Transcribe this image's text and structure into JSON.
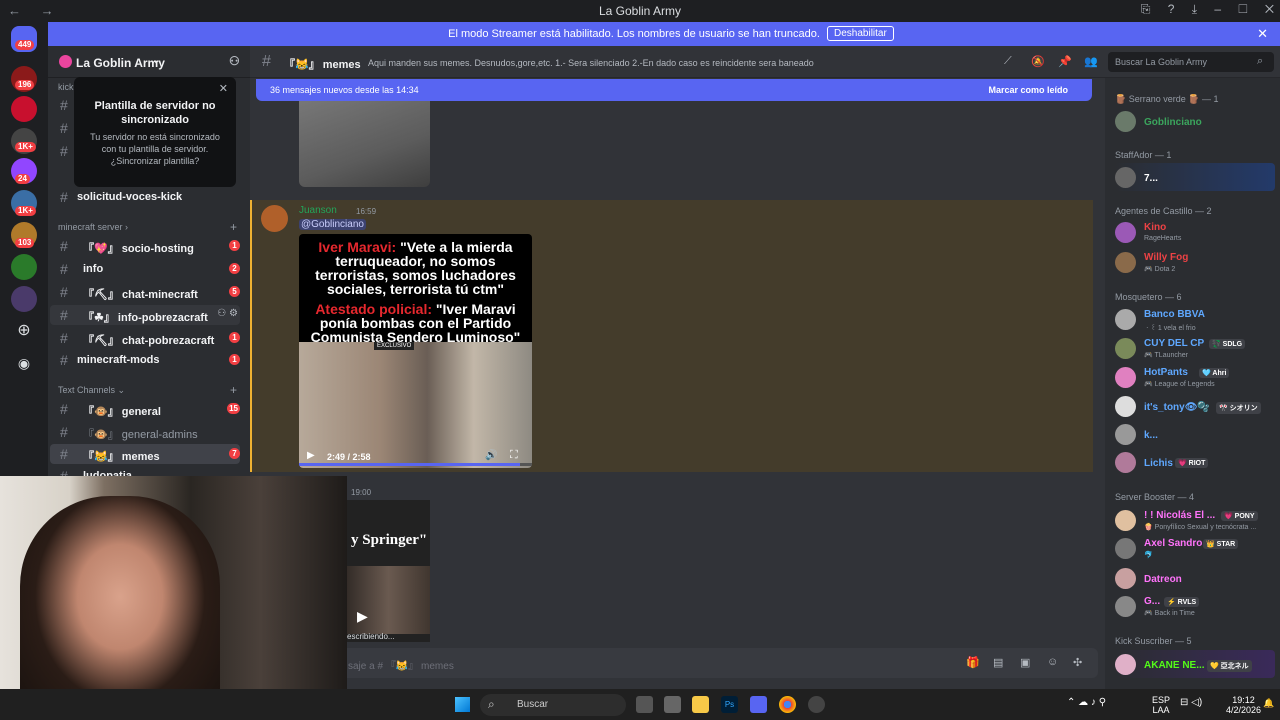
{
  "window": {
    "title": "La Goblin Army",
    "nav": "← →"
  },
  "banner": {
    "text": "El modo Streamer está habilitado. Los nombres de usuario se han truncado.",
    "button": "Deshabilitar"
  },
  "guilds": [
    {
      "badge": "449"
    },
    {
      "badge": "196"
    },
    {
      "badge": ""
    },
    {
      "badge": "1K+"
    },
    {
      "badge": "24"
    },
    {
      "badge": "1K+"
    },
    {
      "badge": "103"
    },
    {
      "badge": ""
    },
    {
      "badge": ""
    }
  ],
  "server": {
    "name": "La Goblin Army"
  },
  "popup": {
    "title": "Plantilla de servidor no sincronizado",
    "body": "Tu servidor no está sincronizado con tu plantilla de servidor. ¿Sincronizar plantilla?"
  },
  "sidebar": {
    "top_fragment": "kick",
    "top_channel": "solicitud-voces-kick",
    "categories": [
      {
        "name": "minecraft server ›"
      },
      {
        "name": "Text Channels ⌄"
      }
    ],
    "minecraft": [
      {
        "label": "『💖』 socio-hosting",
        "badge": "1"
      },
      {
        "label": "info",
        "badge": "2"
      },
      {
        "label": "『⛏』 chat-minecraft",
        "badge": "5"
      },
      {
        "label": "『☘』 info-pobrezacraft",
        "badge": ""
      },
      {
        "label": "『⛏』 chat-pobrezacraft",
        "badge": "1"
      },
      {
        "label": "minecraft-mods",
        "badge": "1"
      }
    ],
    "text": [
      {
        "label": "『🐵』 general",
        "badge": "15"
      },
      {
        "label": "『🐵』 general-admins",
        "badge": ""
      },
      {
        "label": "『😹』 memes",
        "badge": "7"
      },
      {
        "label": "ludopatia",
        "badge": ""
      }
    ]
  },
  "channel": {
    "name": "『😹』 memes",
    "topic": "Aqui manden sus memes. Desnudos,gore,etc. 1.- Sera silenciado 2.-En dado caso es reincidente sera baneado",
    "search_placeholder": "Buscar La Goblin Army"
  },
  "new_messages": {
    "text": "36 mensajes nuevos desde las 14:34",
    "action": "Marcar como leído"
  },
  "messages": [
    {
      "author": "Juanson",
      "time": "16:59",
      "mention": "@Goblinciano",
      "video": {
        "caption_name1": "Iver Maravi:",
        "caption_quote1": "\"Vete a la mierda terruqueador, no somos terroristas, somos luchadores sociales, terrorista tú ctm\"",
        "caption_name2": "Atestado policial:",
        "caption_quote2": "\"Iver Maravi ponía bombas con el Partido Comunista Sendero Luminoso\"",
        "badge": "EXCLUSIVO",
        "time": "2:49 / 2:58",
        "progress": 0.95
      }
    },
    {
      "time": "19:00",
      "image_text": "y Springer\""
    }
  ],
  "typing": "escribiendo...",
  "input_placeholder": "saje a # 『😹』 memes",
  "members": [
    {
      "role": "🪵 Serrano verde 🪵 — 1",
      "list": [
        {
          "name": "Goblinciano",
          "status": "",
          "color": "#3ba55d",
          "tag": ""
        }
      ]
    },
    {
      "role": "StaffAdor — 1",
      "list": [
        {
          "name": "7...",
          "status": "",
          "color": "#ffffff",
          "tag": ""
        }
      ]
    },
    {
      "role": "Agentes de Castillo — 2",
      "list": [
        {
          "name": "Kino",
          "status": "RageHearts",
          "color": "#ed4245",
          "tag": ""
        },
        {
          "name": "Willy Fog",
          "status": "🎮 Dota 2",
          "color": "#ed4245",
          "tag": ""
        }
      ]
    },
    {
      "role": "Mosquetero — 6",
      "list": [
        {
          "name": "Banco BBVA",
          "status": "ㆍ꒰ 1 vela el frio",
          "color": "#5fa8ff",
          "tag": ""
        },
        {
          "name": "CUY DEL CP",
          "status": "🎮 TLauncher",
          "color": "#5fa8ff",
          "tag": "💱 SDLG"
        },
        {
          "name": "HotPants",
          "status": "🎮 League of Legends",
          "color": "#5fa8ff",
          "tag": "🩵 Ahri"
        },
        {
          "name": "it's_tony👁🫧",
          "status": "",
          "color": "#5fa8ff",
          "tag": "🎌 シオリン"
        },
        {
          "name": "k...",
          "status": "",
          "color": "#5fa8ff",
          "tag": ""
        },
        {
          "name": "Lichis",
          "status": "",
          "color": "#5fa8ff",
          "tag": "💗 RIOT"
        }
      ]
    },
    {
      "role": "Server Booster — 4",
      "list": [
        {
          "name": "! ! Nicolás El ...",
          "status": "🍿 Ponyfílico Sexual y tecnócrata ...",
          "color": "#ff73fa",
          "tag": "💗 PONY"
        },
        {
          "name": "Axel Sandro",
          "status": "🐬",
          "color": "#ff73fa",
          "tag": "👑 STAR"
        },
        {
          "name": "Datreon",
          "status": "",
          "color": "#ff73fa",
          "tag": ""
        },
        {
          "name": "G...",
          "status": "🎮 Back in Time",
          "color": "#ff73fa",
          "tag": "⚡ RVLS"
        }
      ]
    },
    {
      "role": "Kick Suscriber — 5",
      "list": [
        {
          "name": "AKANE NE...",
          "status": "",
          "color": "#53fc18",
          "tag": "💛 亞北ネル"
        }
      ]
    }
  ],
  "taskbar": {
    "search": "Buscar",
    "lang": "ESP",
    "lang2": "LAA",
    "time": "19:12",
    "date": "4/2/2026"
  }
}
